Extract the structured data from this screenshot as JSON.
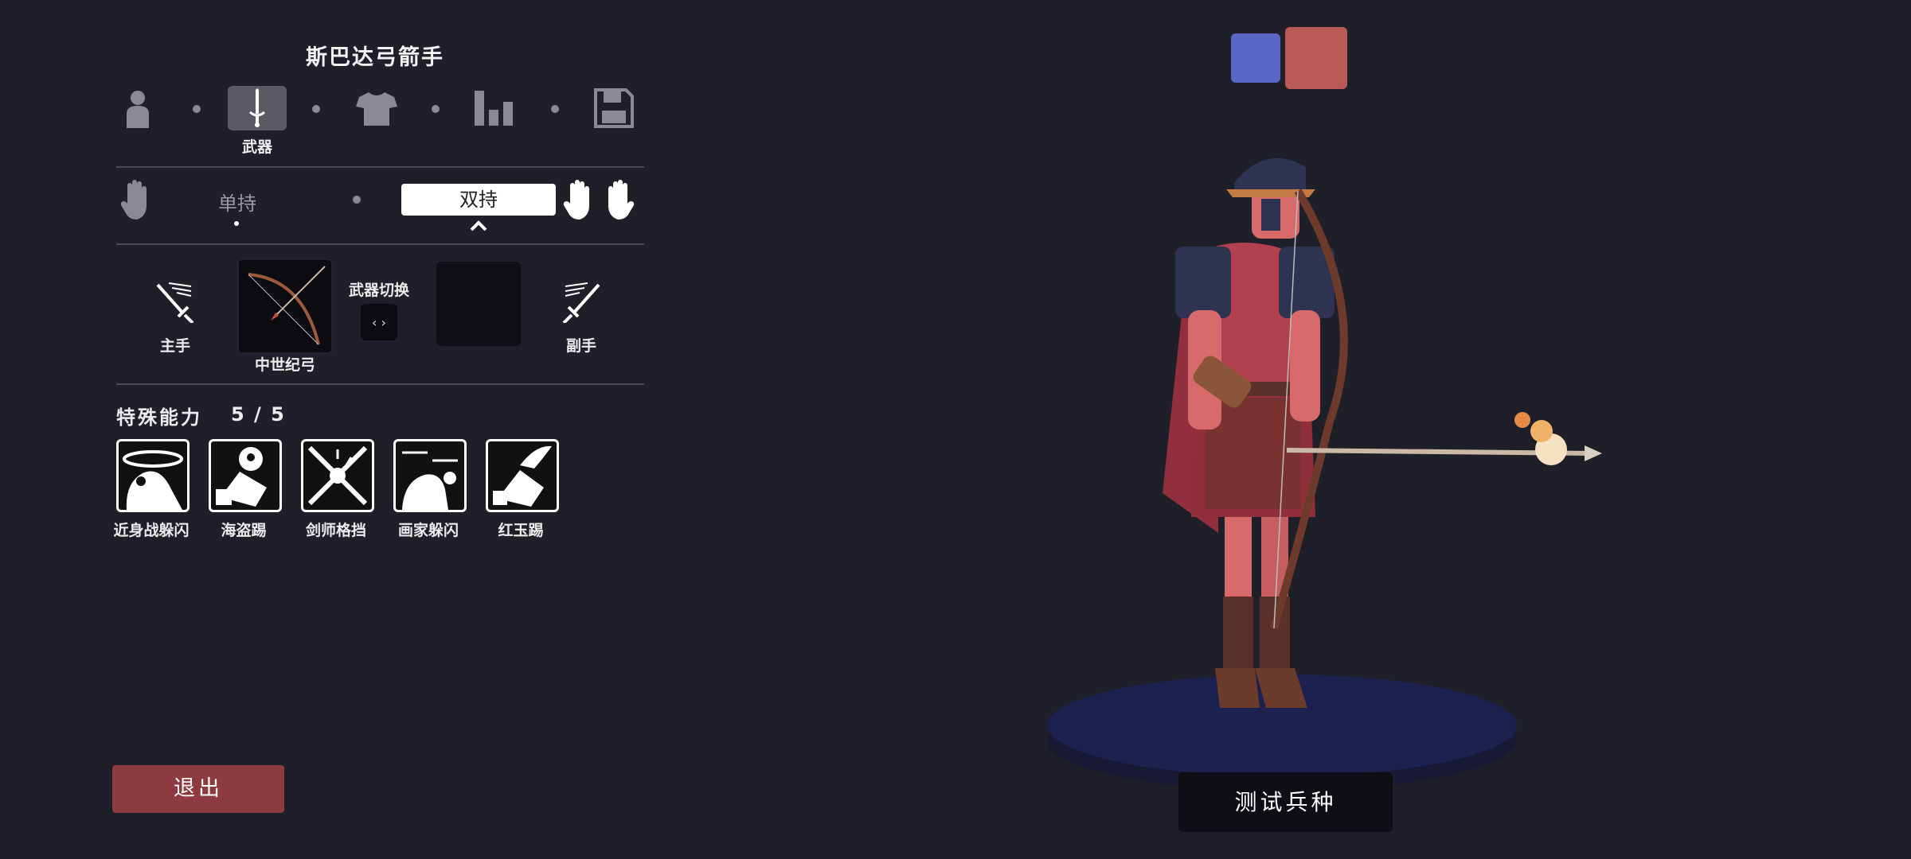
{
  "unit_name": "斯巴达弓箭手",
  "tabs": [
    {
      "id": "body",
      "icon": "person-icon",
      "label": ""
    },
    {
      "id": "weapon",
      "icon": "sword-icon",
      "label": "武器",
      "active": true
    },
    {
      "id": "clothing",
      "icon": "shirt-icon",
      "label": ""
    },
    {
      "id": "stats",
      "icon": "bar-chart-icon",
      "label": ""
    },
    {
      "id": "save",
      "icon": "floppy-disk-icon",
      "label": ""
    }
  ],
  "grip": {
    "single_label": "单持",
    "dual_label": "双持",
    "selected": "dual"
  },
  "weapons": {
    "main_hand_label": "主手",
    "main_weapon_name": "中世纪弓",
    "swap_label": "武器切换",
    "swap_glyph": "‹ ›",
    "off_hand_label": "副手"
  },
  "abilities": {
    "title": "特殊能力",
    "count": "5 / 5",
    "items": [
      {
        "label": "近身战躲闪",
        "icon": "melee-dodge-icon"
      },
      {
        "label": "海盗踢",
        "icon": "pirate-kick-icon"
      },
      {
        "label": "剑师格挡",
        "icon": "sword-parry-icon"
      },
      {
        "label": "画家躲闪",
        "icon": "painter-dodge-icon"
      },
      {
        "label": "红玉踢",
        "icon": "ruby-kick-icon"
      }
    ]
  },
  "exit_label": "退出",
  "test_label": "测试兵种",
  "team_colors": {
    "blue": "#5a67c4",
    "red": "#b85b57",
    "selected": "red"
  }
}
